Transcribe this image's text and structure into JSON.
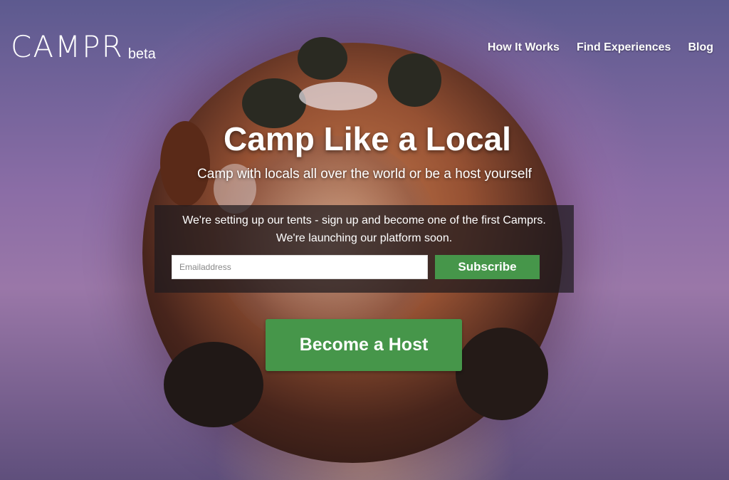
{
  "brand": {
    "name": "CAMPR",
    "tag": "beta"
  },
  "nav": {
    "items": [
      {
        "label": "How It Works"
      },
      {
        "label": "Find Experiences"
      },
      {
        "label": "Blog"
      }
    ]
  },
  "hero": {
    "title": "Camp Like a Local",
    "subtitle": "Camp with locals all over the world or be a host yourself"
  },
  "signup": {
    "line1": "We're setting up our tents - sign up and become one of the first Camprs.",
    "line2": "We're launching our platform soon.",
    "email_placeholder": "Emailaddress",
    "subscribe_label": "Subscribe"
  },
  "cta": {
    "host_label": "Become a Host"
  },
  "colors": {
    "accent": "#46964a",
    "panel": "#1e1a1e"
  }
}
